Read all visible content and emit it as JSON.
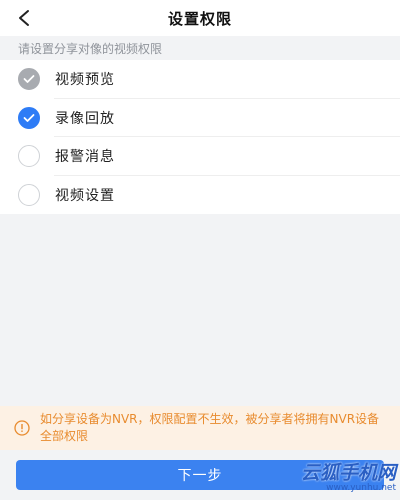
{
  "header": {
    "title": "设置权限"
  },
  "hint": "请设置分享对像的视频权限",
  "permissions": [
    {
      "label": "视频预览",
      "state": "disabled-checked"
    },
    {
      "label": "录像回放",
      "state": "checked"
    },
    {
      "label": "报警消息",
      "state": "unchecked"
    },
    {
      "label": "视频设置",
      "state": "unchecked"
    }
  ],
  "notice": {
    "icon": "info-icon",
    "text": "如分享设备为NVR，权限配置不生效，被分享者将拥有NVR设备全部权限"
  },
  "next_button": "下一步",
  "watermark": {
    "logo": "云狐手机网",
    "url": "www.yunhu.net"
  },
  "colors": {
    "accent": "#2e7cf6",
    "notice_text": "#e88b2e",
    "notice_bg": "#fdf1e4"
  }
}
